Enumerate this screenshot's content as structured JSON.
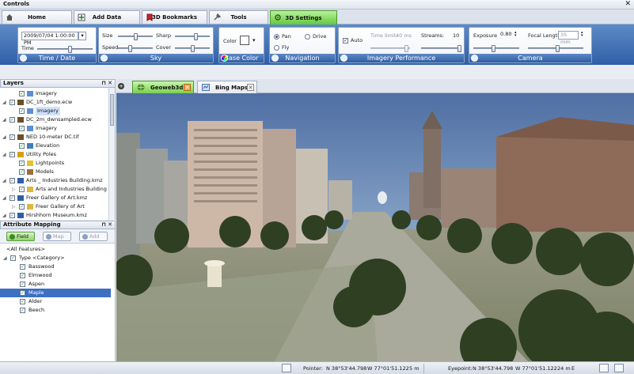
{
  "window": {
    "title": "Controls",
    "close": "✕"
  },
  "tabs": [
    {
      "label": "Home",
      "icon": "home-icon",
      "active": false
    },
    {
      "label": "Add Data",
      "icon": "add-data-icon",
      "active": false
    },
    {
      "label": "3D Bookmarks",
      "icon": "bookmark-icon",
      "active": false
    },
    {
      "label": "Tools",
      "icon": "tools-icon",
      "active": false
    },
    {
      "label": "3D Settings",
      "icon": "settings-icon",
      "active": true
    }
  ],
  "ribbon": {
    "time_date": {
      "group_label": "Time / Date",
      "datetime_value": "2009/07/04 1:00:00 PM",
      "time_label": "Time",
      "time_level": 0.55
    },
    "sky": {
      "group_label": "Sky",
      "size_label": "Size",
      "sharp_label": "Sharp",
      "speed_label": "Speed",
      "cover_label": "Cover",
      "size_level": 0.45,
      "sharp_level": 0.55,
      "speed_level": 0.3,
      "cover_level": 0.45
    },
    "base_color": {
      "group_label": "Base Color",
      "color_label": "Color",
      "color_value": "#ffffff"
    },
    "navigation": {
      "group_label": "Navigation",
      "pan_label": "Pan",
      "drive_label": "Drive",
      "fly_label": "Fly",
      "selected": "Pan"
    },
    "imagery": {
      "group_label": "Imagery Performance",
      "auto_label": "Auto",
      "auto_checked": "✓",
      "time_limit_label": "Time limit:",
      "time_limit_value": "40 ms",
      "streams_label": "Streams:",
      "streams_value": "10",
      "time_limit_level": 0.85,
      "streams_level": 0.95
    },
    "camera": {
      "group_label": "Camera",
      "exposure_label": "Exposure",
      "exposure_value": "0.80",
      "focal_label": "Focal Length",
      "focal_value": "35 mm",
      "exposure_level": 0.4,
      "focal_level": 0.5
    }
  },
  "layers_panel": {
    "title": "Layers",
    "pin": "⊓",
    "close": "✕",
    "items": [
      {
        "label": "Imagery",
        "indent": 1,
        "checked": true,
        "icon": "imagery-icon",
        "selected": false,
        "expander": ""
      },
      {
        "label": "DC_1ft_demo.ecw",
        "indent": 0,
        "checked": true,
        "icon": "raster-file-icon",
        "selected": false,
        "expander": "◢"
      },
      {
        "label": "Imagery",
        "indent": 1,
        "checked": true,
        "icon": "imagery-icon",
        "selected": true,
        "expander": ""
      },
      {
        "label": "DC_2m_dwnsampled.ecw",
        "indent": 0,
        "checked": true,
        "icon": "raster-file-icon",
        "selected": false,
        "expander": "◢"
      },
      {
        "label": "Imagery",
        "indent": 1,
        "checked": true,
        "icon": "imagery-icon",
        "selected": false,
        "expander": ""
      },
      {
        "label": "NED 10-meter DC.tif",
        "indent": 0,
        "checked": true,
        "icon": "raster-file-icon",
        "selected": false,
        "expander": "◢"
      },
      {
        "label": "Elevation",
        "indent": 1,
        "checked": true,
        "icon": "elevation-icon",
        "selected": false,
        "expander": ""
      },
      {
        "label": "Utility Poles",
        "indent": 0,
        "checked": true,
        "icon": "layer-group-icon",
        "selected": false,
        "expander": "◢"
      },
      {
        "label": "Lightpoints",
        "indent": 1,
        "checked": true,
        "icon": "point-layer-icon",
        "selected": false,
        "expander": ""
      },
      {
        "label": "Models",
        "indent": 1,
        "checked": true,
        "icon": "model-icon",
        "selected": false,
        "expander": ""
      },
      {
        "label": "Arts _ Industries Building.kmz",
        "indent": 0,
        "checked": true,
        "icon": "kmz-icon",
        "selected": false,
        "expander": "◢"
      },
      {
        "label": "Arts and Industries Building",
        "indent": 1,
        "checked": true,
        "icon": "folder-icon",
        "selected": false,
        "expander": "▷"
      },
      {
        "label": "Freer Gallery of Art.kmz",
        "indent": 0,
        "checked": true,
        "icon": "kmz-icon",
        "selected": false,
        "expander": "◢"
      },
      {
        "label": "Freer Gallery of Art",
        "indent": 1,
        "checked": true,
        "icon": "folder-icon",
        "selected": false,
        "expander": "▷"
      },
      {
        "label": "Hirshhorn Museum.kmz",
        "indent": 0,
        "checked": true,
        "icon": "kmz-icon",
        "selected": false,
        "expander": "◢"
      }
    ]
  },
  "attribute_panel": {
    "title": "Attribute Mapping",
    "pin": "⊓",
    "close": "✕",
    "buttons": [
      {
        "label": "Field",
        "enabled": true
      },
      {
        "label": "Map",
        "enabled": false
      },
      {
        "label": "Add",
        "enabled": false
      }
    ],
    "items": [
      {
        "label": "<All Features>",
        "indent": 0,
        "checkbox": false,
        "selected": false,
        "expander": ""
      },
      {
        "label": "Type <Category>",
        "indent": 0,
        "checkbox": true,
        "selected": false,
        "expander": "◢"
      },
      {
        "label": "Basswood",
        "indent": 1,
        "checkbox": true,
        "selected": false,
        "expander": ""
      },
      {
        "label": "Elmwood",
        "indent": 1,
        "checkbox": true,
        "selected": false,
        "expander": ""
      },
      {
        "label": "Aspen",
        "indent": 1,
        "checkbox": true,
        "selected": false,
        "expander": ""
      },
      {
        "label": "Maple",
        "indent": 1,
        "checkbox": true,
        "selected": true,
        "expander": ""
      },
      {
        "label": "Alder",
        "indent": 1,
        "checkbox": true,
        "selected": false,
        "expander": ""
      },
      {
        "label": "Beech",
        "indent": 1,
        "checkbox": true,
        "selected": false,
        "expander": ""
      }
    ]
  },
  "view_tabs": [
    {
      "label": "Geoweb3d",
      "active": true,
      "close": "✕"
    },
    {
      "label": "Bing Maps",
      "active": false,
      "close": "✕"
    }
  ],
  "add_tab": "+",
  "status": {
    "pointer_label": "Pointer:",
    "pointer_n": "N  38°53'44.798",
    "pointer_w": "W  77°01'51.122",
    "pointer_alt": "5 m",
    "eyepoint_label": "Eyepoint:",
    "eye_n": "N  38°53'44.798",
    "eye_w": "W  77°01'51.122",
    "eye_alt": "24 m",
    "eye_heading": "E"
  },
  "colors": {
    "accent_green": "#79d14d",
    "ribbon_blue": "#2f5fa6"
  }
}
